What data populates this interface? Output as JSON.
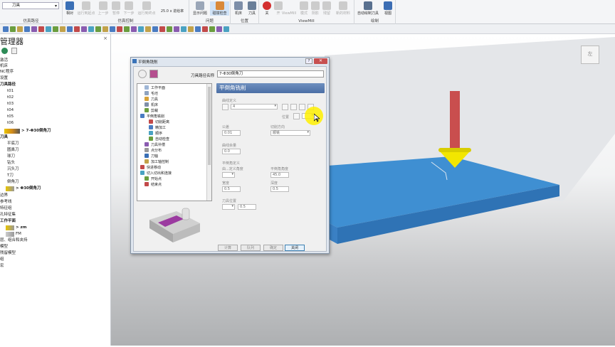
{
  "ribbon": {
    "tool_combo": "刀具",
    "groups": [
      {
        "label": "仿真路径"
      },
      {
        "label": "仿真控制"
      },
      {
        "label": "问题"
      },
      {
        "label": "位置"
      },
      {
        "label": "ViewMill"
      },
      {
        "label": "绘制"
      }
    ],
    "buttons": {
      "relative": "相对",
      "play_to_start": "运行到起点",
      "prev": "上一步",
      "pause": "暂停",
      "next": "下一步",
      "run_to_end": "运行到终点",
      "speed": "25.0 x 进给率",
      "show_problems": "显示问题",
      "collision_check": "碰撞检查",
      "machine": "机床",
      "tool": "刀具",
      "off": "关",
      "on": "开",
      "viewmill": "ViewMill",
      "mode": "模式",
      "shading": "阴影",
      "rest": "残留",
      "new_material": "新的材料",
      "auto_draw_tool": "自动绘制刀具",
      "view": "视图"
    }
  },
  "panel": {
    "title": "管理器",
    "tree": [
      "激活",
      "机床",
      "NC程序",
      "设置",
      "刀具路径",
      "t01",
      "t02",
      "t03",
      "t04",
      "t05",
      "t06",
      "> 7-Φ30倒角刀",
      "刀具",
      "平底刀",
      "圆鼻刀",
      "球刀",
      "钻头",
      "沉头刀",
      "T刀",
      "倒角刀",
      "> Φ30倒角刀",
      "边界",
      "参考线",
      "特征组",
      "孔特征集",
      "工作平面",
      "> zm",
      "FM",
      "层、组合和夹持",
      "模型",
      "残留模型",
      "组",
      "宏"
    ]
  },
  "dialog": {
    "title": "平倒角铣削",
    "help": "?",
    "name_label": "刀具路径名称",
    "name_value": "7-Φ30倒角刀",
    "tree": [
      "工作平面",
      "毛坯",
      "刀具",
      "机床",
      "剪裁",
      "平倒角铣削",
      "切削距离",
      "精加工",
      "顺序",
      "自动检查",
      "刀具补偿",
      "点分布",
      "刀轴",
      "加工轴控制",
      "快进移动",
      "切入切出和连接",
      "开始点",
      "结束点"
    ],
    "form_title": "平倒角铣削",
    "curve_def": "曲线定义",
    "curve_value": "4",
    "position_label": "位置",
    "tolerance_label": "公差",
    "tolerance_value": "0.01",
    "cut_dir_label": "切削方向",
    "cut_dir_value": "顺铣",
    "curve_allow_label": "曲线余量",
    "curve_allow_value": "0.0",
    "chamfer_def": "平倒角定义",
    "from_tool_angle": "由...定义角度",
    "chamfer_angle_label": "平倒角角度",
    "chamfer_angle_value": "45.0",
    "width_label": "宽度",
    "width_value": "0.5",
    "depth_label": "深度",
    "depth_value": "0.5",
    "tool_pos": "刀具位置",
    "tool_pos_value": "0.5",
    "buttons": {
      "calc": "计算",
      "queue": "队列",
      "ok": "确定",
      "close": "关闭"
    }
  },
  "viewcube": "左"
}
